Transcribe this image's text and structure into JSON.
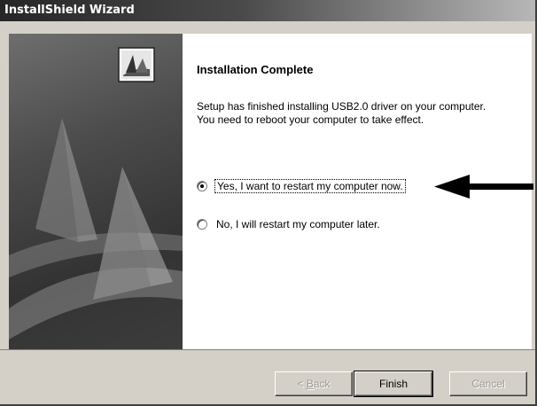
{
  "window": {
    "title": "InstallShield Wizard"
  },
  "banner": {
    "logo_icon": "installshield-logo-icon"
  },
  "content": {
    "heading": "Installation Complete",
    "message_lines": [
      "Setup has finished installing USB2.0 driver on your computer.",
      "You need to reboot your computer to take effect."
    ],
    "options": [
      {
        "label": "Yes, I want to restart my computer now.",
        "selected": true
      },
      {
        "label": "No, I will restart my computer later.",
        "selected": false
      }
    ],
    "annotation_icon": "arrow-left-icon"
  },
  "buttons": {
    "back_prefix": "< ",
    "back_underlined": "B",
    "back_rest": "ack",
    "finish": "Finish",
    "cancel": "Cancel"
  }
}
